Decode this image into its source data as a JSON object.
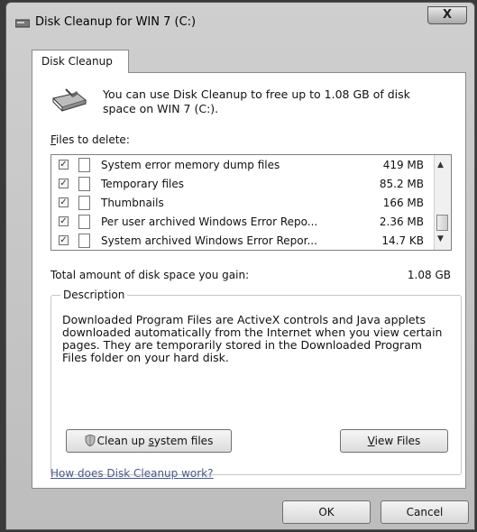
{
  "window": {
    "title": "Disk Cleanup for WIN 7 (C:)",
    "close_label": "X"
  },
  "tab": {
    "label": "Disk Cleanup"
  },
  "intro": {
    "text": "You can use Disk Cleanup to free up to 1.08 GB of disk space on WIN 7 (C:)."
  },
  "files": {
    "label_accel": "F",
    "label_rest": "iles to delete:",
    "items": [
      {
        "name": "System error memory dump files",
        "size": "419 MB",
        "checked": true
      },
      {
        "name": "Temporary files",
        "size": "85.2 MB",
        "checked": true
      },
      {
        "name": "Thumbnails",
        "size": "166 MB",
        "checked": true
      },
      {
        "name": "Per user archived Windows Error Repo...",
        "size": "2.36 MB",
        "checked": true
      },
      {
        "name": "System archived Windows Error Repor...",
        "size": "14.7 KB",
        "checked": true
      }
    ]
  },
  "total": {
    "label": "Total amount of disk space you gain:",
    "value": "1.08 GB"
  },
  "description": {
    "legend": "Description",
    "text": "Downloaded Program Files are ActiveX controls and Java applets downloaded automatically from the Internet when you view certain pages. They are temporarily stored in the Downloaded Program Files folder on your hard disk."
  },
  "buttons": {
    "cleanup_pre": "Clean up ",
    "cleanup_accel": "s",
    "cleanup_post": "ystem files",
    "view_accel": "V",
    "view_rest": "iew Files",
    "ok": "OK",
    "cancel": "Cancel"
  },
  "help_link": "How does Disk Cleanup work?",
  "icons": {
    "check": "✓",
    "scroll_up": "▲",
    "scroll_down": "▼"
  }
}
